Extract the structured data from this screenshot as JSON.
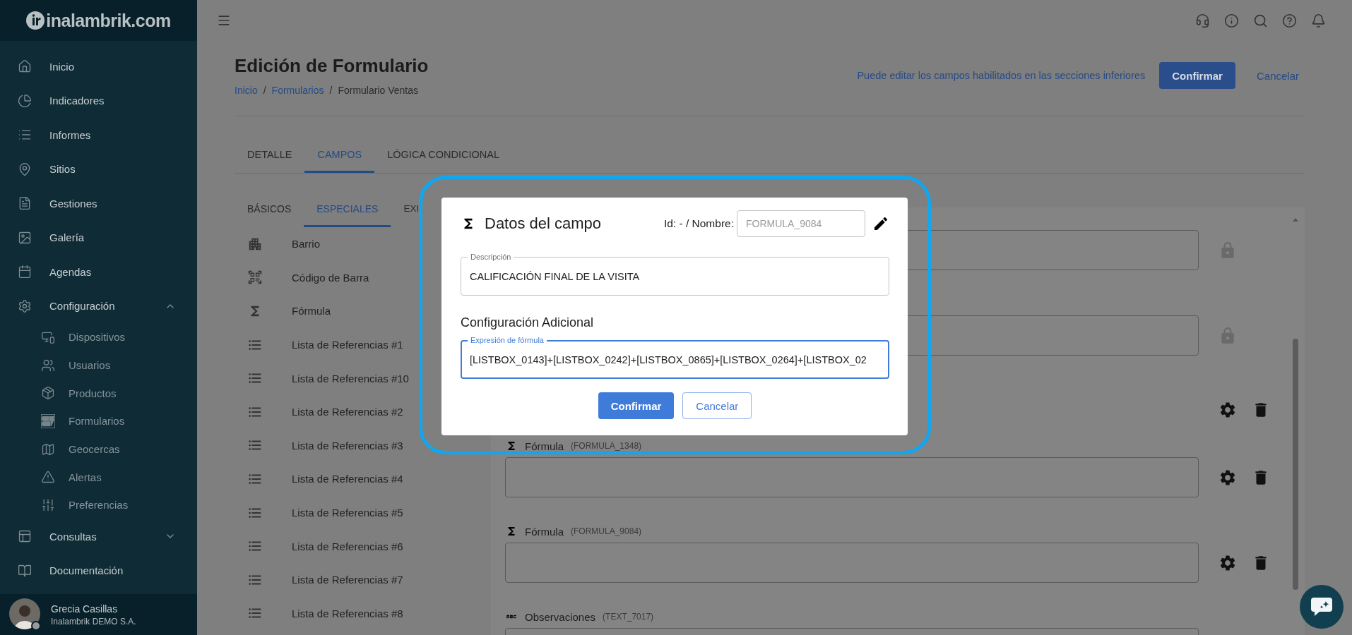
{
  "sidebar": {
    "logo": "inalambrik.com",
    "items": [
      {
        "label": "Inicio"
      },
      {
        "label": "Indicadores"
      },
      {
        "label": "Informes"
      },
      {
        "label": "Sitios"
      },
      {
        "label": "Gestiones"
      },
      {
        "label": "Galería"
      },
      {
        "label": "Agendas"
      },
      {
        "label": "Configuración",
        "expanded": true,
        "children": [
          {
            "label": "Dispositivos"
          },
          {
            "label": "Usuarios"
          },
          {
            "label": "Productos"
          },
          {
            "label": "Formularios"
          },
          {
            "label": "Geocercas"
          },
          {
            "label": "Alertas"
          },
          {
            "label": "Preferencias"
          }
        ]
      },
      {
        "label": "Consultas",
        "expanded": false
      },
      {
        "label": "Documentación"
      }
    ],
    "user": {
      "name": "Grecia Casillas",
      "company": "Inalambrik DEMO S.A."
    }
  },
  "header": {
    "title": "Edición de Formulario",
    "breadcrumb": [
      {
        "label": "Inicio",
        "link": true
      },
      {
        "label": "Formularios",
        "link": true
      },
      {
        "label": "Formulario Ventas",
        "link": false
      }
    ],
    "breadcrumb_separator": "/",
    "notice": "Puede editar los campos habilitados en las secciones inferiores",
    "confirm_button": "Confirmar",
    "cancel_button": "Cancelar"
  },
  "tabs": [
    {
      "label": "DETALLE",
      "selected": false
    },
    {
      "label": "CAMPOS",
      "selected": true
    },
    {
      "label": "LÓGICA CONDICIONAL",
      "selected": false
    }
  ],
  "subtabs": [
    {
      "label": "BÁSICOS",
      "selected": false
    },
    {
      "label": "ESPECIALES",
      "selected": true
    },
    {
      "label": "EXI",
      "selected": false
    }
  ],
  "field_types": [
    {
      "kind": "neighborhood",
      "label": "Barrio"
    },
    {
      "kind": "barcode",
      "label": "Código de Barra"
    },
    {
      "kind": "formula",
      "label": "Fórmula"
    },
    {
      "kind": "list",
      "label": "Lista de Referencias #1"
    },
    {
      "kind": "list",
      "label": "Lista de Referencias #10"
    },
    {
      "kind": "list",
      "label": "Lista de Referencias #2"
    },
    {
      "kind": "list",
      "label": "Lista de Referencias #3"
    },
    {
      "kind": "list",
      "label": "Lista de Referencias #4"
    },
    {
      "kind": "list",
      "label": "Lista de Referencias #5"
    },
    {
      "kind": "list",
      "label": "Lista de Referencias #6"
    },
    {
      "kind": "list",
      "label": "Lista de Referencias #7"
    },
    {
      "kind": "list",
      "label": "Lista de Referencias #8"
    }
  ],
  "form_fields": [
    {
      "locked": true
    },
    {
      "locked": true
    },
    {
      "locked": false,
      "box": false
    },
    {
      "kind": "formula",
      "label": "Fórmula",
      "code": "(FORMULA_1348)",
      "locked": false
    },
    {
      "kind": "formula",
      "label": "Fórmula",
      "code": "(FORMULA_9084)",
      "locked": false
    },
    {
      "kind": "text",
      "label": "Observaciones",
      "code": "(TEXT_7017)"
    }
  ],
  "dialog": {
    "title": "Datos del campo",
    "id_label": "Id: - / Nombre:",
    "name_value": "FORMULA_9084",
    "name_disabled": true,
    "description": {
      "label": "Descripción",
      "value": "CALIFICACIÓN FINAL DE LA VISITA"
    },
    "section_title": "Configuración Adicional",
    "formula": {
      "label": "Expresión de fórmula",
      "value": "[LISTBOX_0143]+[LISTBOX_0242]+[LISTBOX_0865]+[LISTBOX_0264]+[LISTBOX_02",
      "focused": true
    },
    "confirm_button": "Confirmar",
    "cancel_button": "Cancelar"
  }
}
